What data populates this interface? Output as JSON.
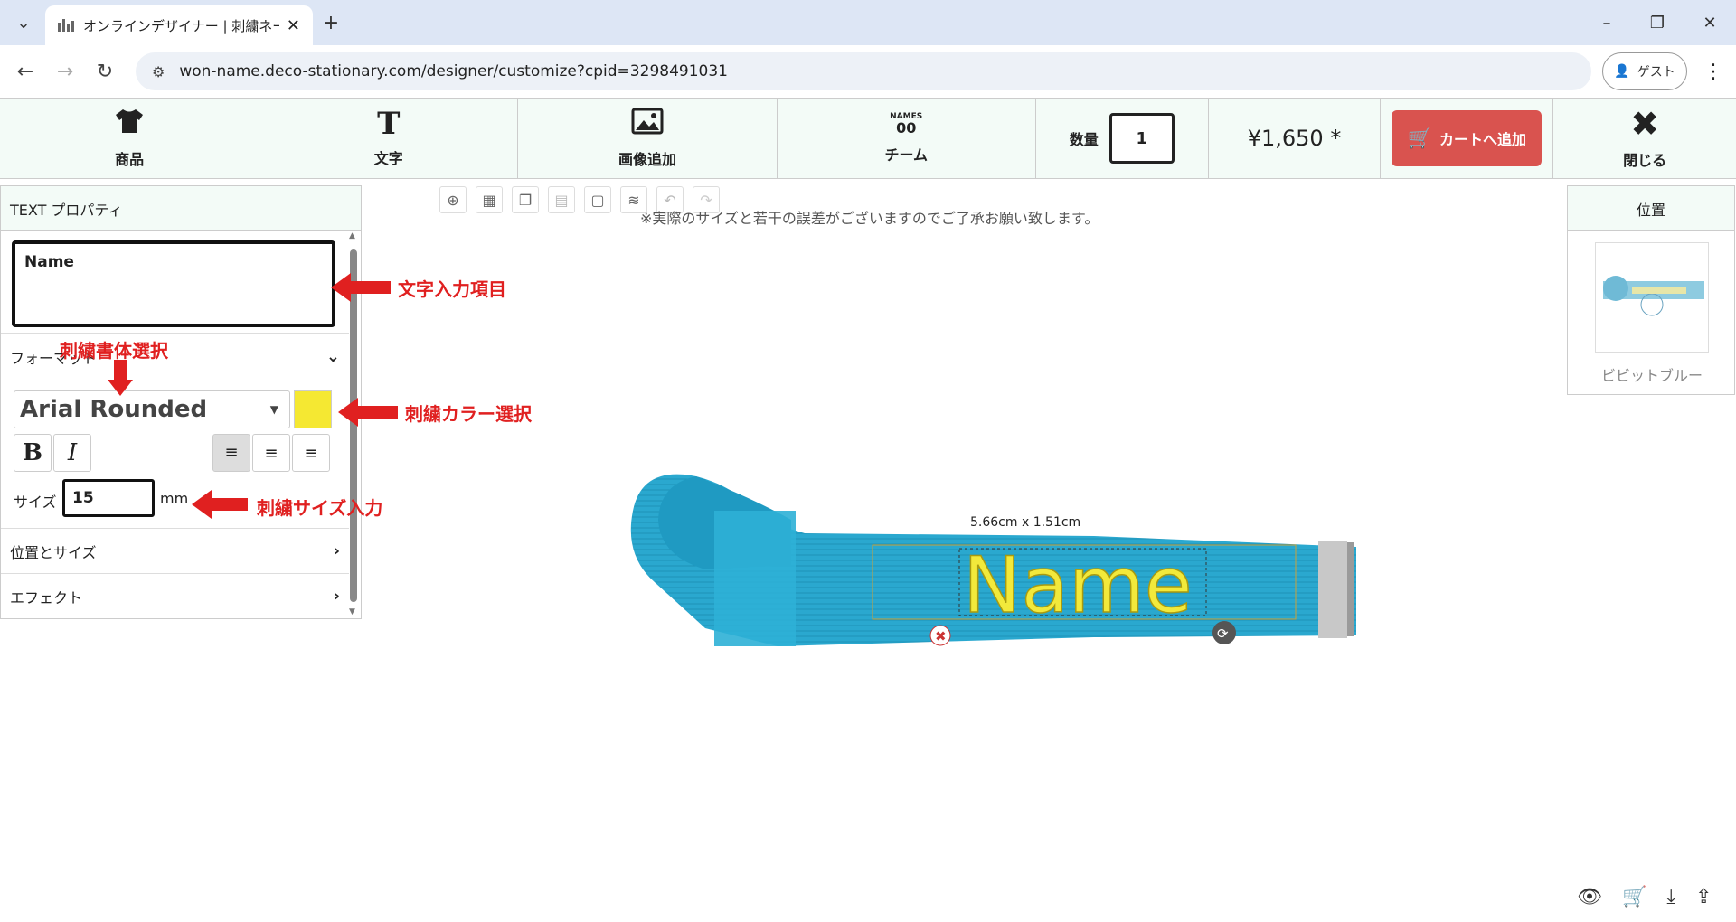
{
  "browser": {
    "tab_title": "オンラインデザイナー | 刺繍ネームタグ",
    "tab_close": "✕",
    "new_tab": "+",
    "url": "won-name.deco-stationary.com/designer/customize?cpid=3298491031",
    "guest_label": "ゲスト"
  },
  "toolbar": {
    "product_label": "商品",
    "text_label": "文字",
    "image_label": "画像追加",
    "team_label": "チーム",
    "team_icon_text": "NAMES",
    "team_icon_num": "00",
    "qty_label": "数量",
    "qty_value": "1",
    "price": "¥1,650 *",
    "cart_label": "カートへ追加",
    "close_label": "閉じる"
  },
  "left_panel": {
    "title": "TEXT プロパティ",
    "text_value": "Name",
    "format_label": "フォーマット",
    "font_name": "Arial Rounded",
    "bold": "B",
    "italic": "I",
    "size_label": "サイズ",
    "size_value": "15",
    "size_unit": "mm",
    "pos_size_label": "位置とサイズ",
    "effect_label": "エフェクト",
    "color": "#f5e832"
  },
  "annotations": {
    "text_input": "文字入力項目",
    "font_select": "刺繍書体選択",
    "color_select": "刺繍カラー選択",
    "size_input": "刺繍サイズ入力"
  },
  "canvas": {
    "notice": "※実際のサイズと若干の誤差がございますのでご了承お願い致します。",
    "dimensions": "5.66cm x 1.51cm",
    "text": "Name",
    "tag_color": "#2aa8cf",
    "text_color": "#f2e93b"
  },
  "right_panel": {
    "title": "位置",
    "thumb_label": "ビビットブルー"
  }
}
